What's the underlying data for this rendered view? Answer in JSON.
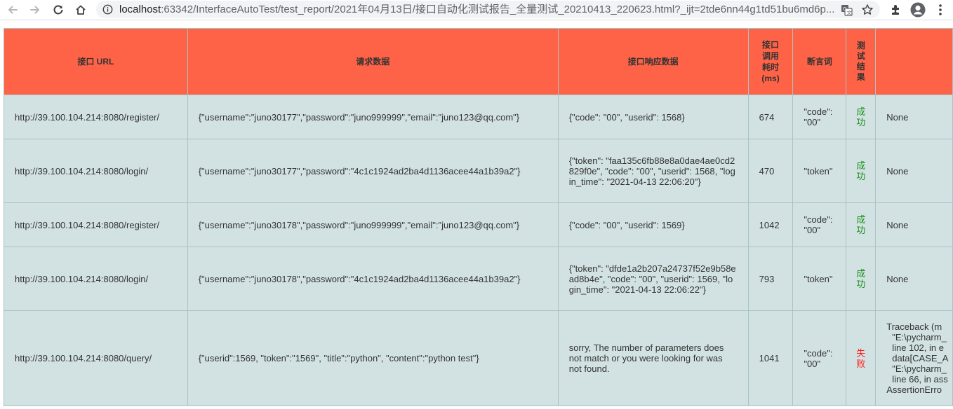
{
  "browser": {
    "url_host": "localhost",
    "url_rest": ":63342/InterfaceAutoTest/test_report/2021年04月13日/接口自动化测试报告_全量测试_20210413_220623.html?_ijt=2tde6nn44g1td51bu6md6p..."
  },
  "table": {
    "headers": {
      "url": "接口 URL",
      "request": "请求数据",
      "response": "接口响应数据",
      "time": "接口调用耗时(ms)",
      "assert": "断言词",
      "result": "测试结果",
      "error": ""
    },
    "rows": [
      {
        "url": "http://39.100.104.214:8080/register/",
        "request": "{\"username\":\"juno30177\",\"password\":\"juno999999\",\"email\":\"juno123@qq.com\"}",
        "response": "{\"code\": \"00\", \"userid\": 1568}",
        "time": "674",
        "assert": "\"code\": \"00\"",
        "result": "成功",
        "error": "None"
      },
      {
        "url": "http://39.100.104.214:8080/login/",
        "request": "{\"username\":\"juno30177\",\"password\":\"4c1c1924ad2ba4d1136acee44a1b39a2\"}",
        "response": "{\"token\": \"faa135c6fb88e8a0dae4ae0cd2829f0e\", \"code\": \"00\", \"userid\": 1568, \"login_time\": \"2021-04-13 22:06:20\"}",
        "time": "470",
        "assert": "\"token\"",
        "result": "成功",
        "error": "None"
      },
      {
        "url": "http://39.100.104.214:8080/register/",
        "request": "{\"username\":\"juno30178\",\"password\":\"juno999999\",\"email\":\"juno123@qq.com\"}",
        "response": "{\"code\": \"00\", \"userid\": 1569}",
        "time": "1042",
        "assert": "\"code\": \"00\"",
        "result": "成功",
        "error": "None"
      },
      {
        "url": "http://39.100.104.214:8080/login/",
        "request": "{\"username\":\"juno30178\",\"password\":\"4c1c1924ad2ba4d1136acee44a1b39a2\"}",
        "response": "{\"token\": \"dfde1a2b207a24737f52e9b58ead8b4e\", \"code\": \"00\", \"userid\": 1569, \"login_time\": \"2021-04-13 22:06:22\"}",
        "time": "793",
        "assert": "\"token\"",
        "result": "成功",
        "error": "None"
      },
      {
        "url": "http://39.100.104.214:8080/query/",
        "request": "{\"userid\":1569, \"token\":\"1569\", \"title\":\"python\", \"content\":\"python test\"}",
        "response": "sorry, The number of parameters does not match or you were looking for was not found.",
        "time": "1041",
        "assert": "\"code\": \"00\"",
        "result": "失败",
        "error_lines": [
          "Traceback (m",
          "\"E:\\pycharm_",
          "line 102, in e",
          "data[CASE_A",
          "\"E:\\pycharm_",
          "line 66, in ass",
          "AssertionErro"
        ]
      }
    ]
  },
  "colors": {
    "header_bg": "#ff6347",
    "cell_bg": "#d2e2e3",
    "pass": "#1a8f1a",
    "fail": "#ff1a1a"
  },
  "icons": [
    "back-icon",
    "forward-icon",
    "reload-icon",
    "home-icon",
    "info-icon",
    "translate-icon",
    "bookmark-star-icon",
    "extensions-icon",
    "profile-icon",
    "menu-icon"
  ]
}
